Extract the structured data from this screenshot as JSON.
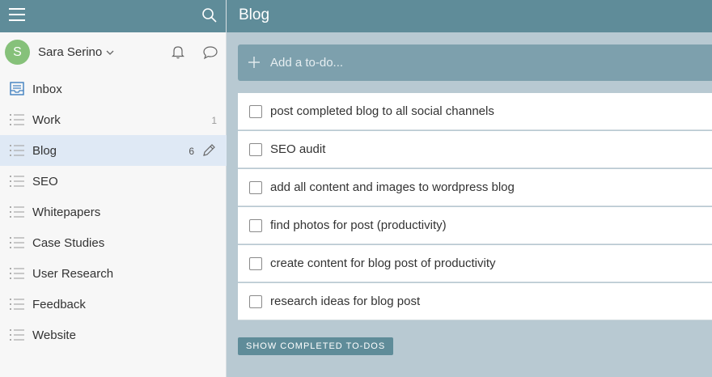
{
  "user": {
    "initial": "S",
    "name": "Sara Serino"
  },
  "sidebar": {
    "items": [
      {
        "label": "Inbox",
        "count": "",
        "icon": "inbox-icon"
      },
      {
        "label": "Work",
        "count": "1",
        "icon": "list-icon"
      },
      {
        "label": "Blog",
        "count": "6",
        "icon": "list-icon"
      },
      {
        "label": "SEO",
        "count": "",
        "icon": "list-icon"
      },
      {
        "label": "Whitepapers",
        "count": "",
        "icon": "list-icon"
      },
      {
        "label": "Case Studies",
        "count": "",
        "icon": "list-icon"
      },
      {
        "label": "User Research",
        "count": "",
        "icon": "list-icon"
      },
      {
        "label": "Feedback",
        "count": "",
        "icon": "list-icon"
      },
      {
        "label": "Website",
        "count": "",
        "icon": "list-icon"
      }
    ]
  },
  "main": {
    "title": "Blog",
    "add_placeholder": "Add a to-do...",
    "tasks": [
      "post completed blog to all social channels",
      "SEO audit",
      "add all content and images to wordpress blog",
      "find photos for post (productivity)",
      "create content for blog post of productivity",
      "research ideas for blog post"
    ],
    "show_completed_label": "SHOW COMPLETED TO-DOS"
  },
  "colors": {
    "header": "#5f8c99",
    "add_bar": "#7da0ad",
    "background": "#b8c9d2",
    "active_item": "#dfe9f5",
    "avatar": "#86c17a"
  }
}
